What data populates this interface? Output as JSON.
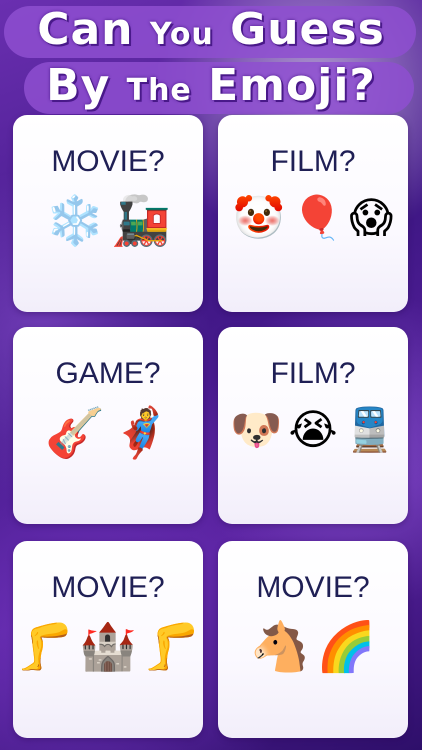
{
  "title": {
    "line1_big_1": "Can",
    "line1_small": "You",
    "line1_big_2": "Guess",
    "line2_big_1": "By",
    "line2_small": "The",
    "line2_big_2": "Emoji?"
  },
  "cards": [
    {
      "label": "MOVIE?",
      "emojis": [
        "❄️",
        "🚂"
      ]
    },
    {
      "label": "FILM?",
      "emojis": [
        "🤡",
        "🎈",
        "😱"
      ]
    },
    {
      "label": "GAME?",
      "emojis": [
        "🎸",
        "🦸"
      ]
    },
    {
      "label": "FILM?",
      "emojis": [
        "🐶",
        "😭",
        "🚆"
      ]
    },
    {
      "label": "MOVIE?",
      "emojis": [
        "🦵",
        "🏰",
        "🦵"
      ]
    },
    {
      "label": "MOVIE?",
      "emojis": [
        "🐴",
        "🌈"
      ]
    }
  ],
  "colors": {
    "background": "#4a1b90",
    "card": "#ffffff",
    "label_text": "#1f1f55",
    "title_text": "#ffffff"
  }
}
